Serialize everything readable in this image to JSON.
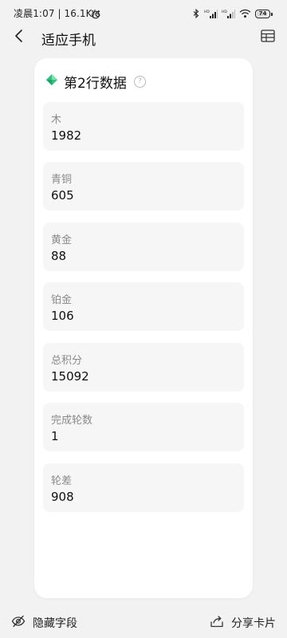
{
  "status_bar": {
    "time_text": "凌晨1:07 | 16.1K/s",
    "battery_level": "74",
    "battery_fraction": 0.74
  },
  "header": {
    "title": "适应手机",
    "back_icon": "chevron-left-icon",
    "table_icon": "table-icon"
  },
  "card": {
    "title": "第2行数据",
    "title_icon_color": "#2ec27e",
    "help_icon": "question-circle-icon",
    "fields": [
      {
        "label": "木",
        "value": "1982"
      },
      {
        "label": "青铜",
        "value": "605"
      },
      {
        "label": "黄金",
        "value": "88"
      },
      {
        "label": "铂金",
        "value": "106"
      },
      {
        "label": "总积分",
        "value": "15092"
      },
      {
        "label": "完成轮数",
        "value": "1"
      },
      {
        "label": "轮差",
        "value": "908"
      }
    ]
  },
  "bottom_bar": {
    "hide_fields_label": "隐藏字段",
    "share_card_label": "分享卡片",
    "hide_icon": "eye-slash-icon",
    "share_icon": "share-icon"
  }
}
